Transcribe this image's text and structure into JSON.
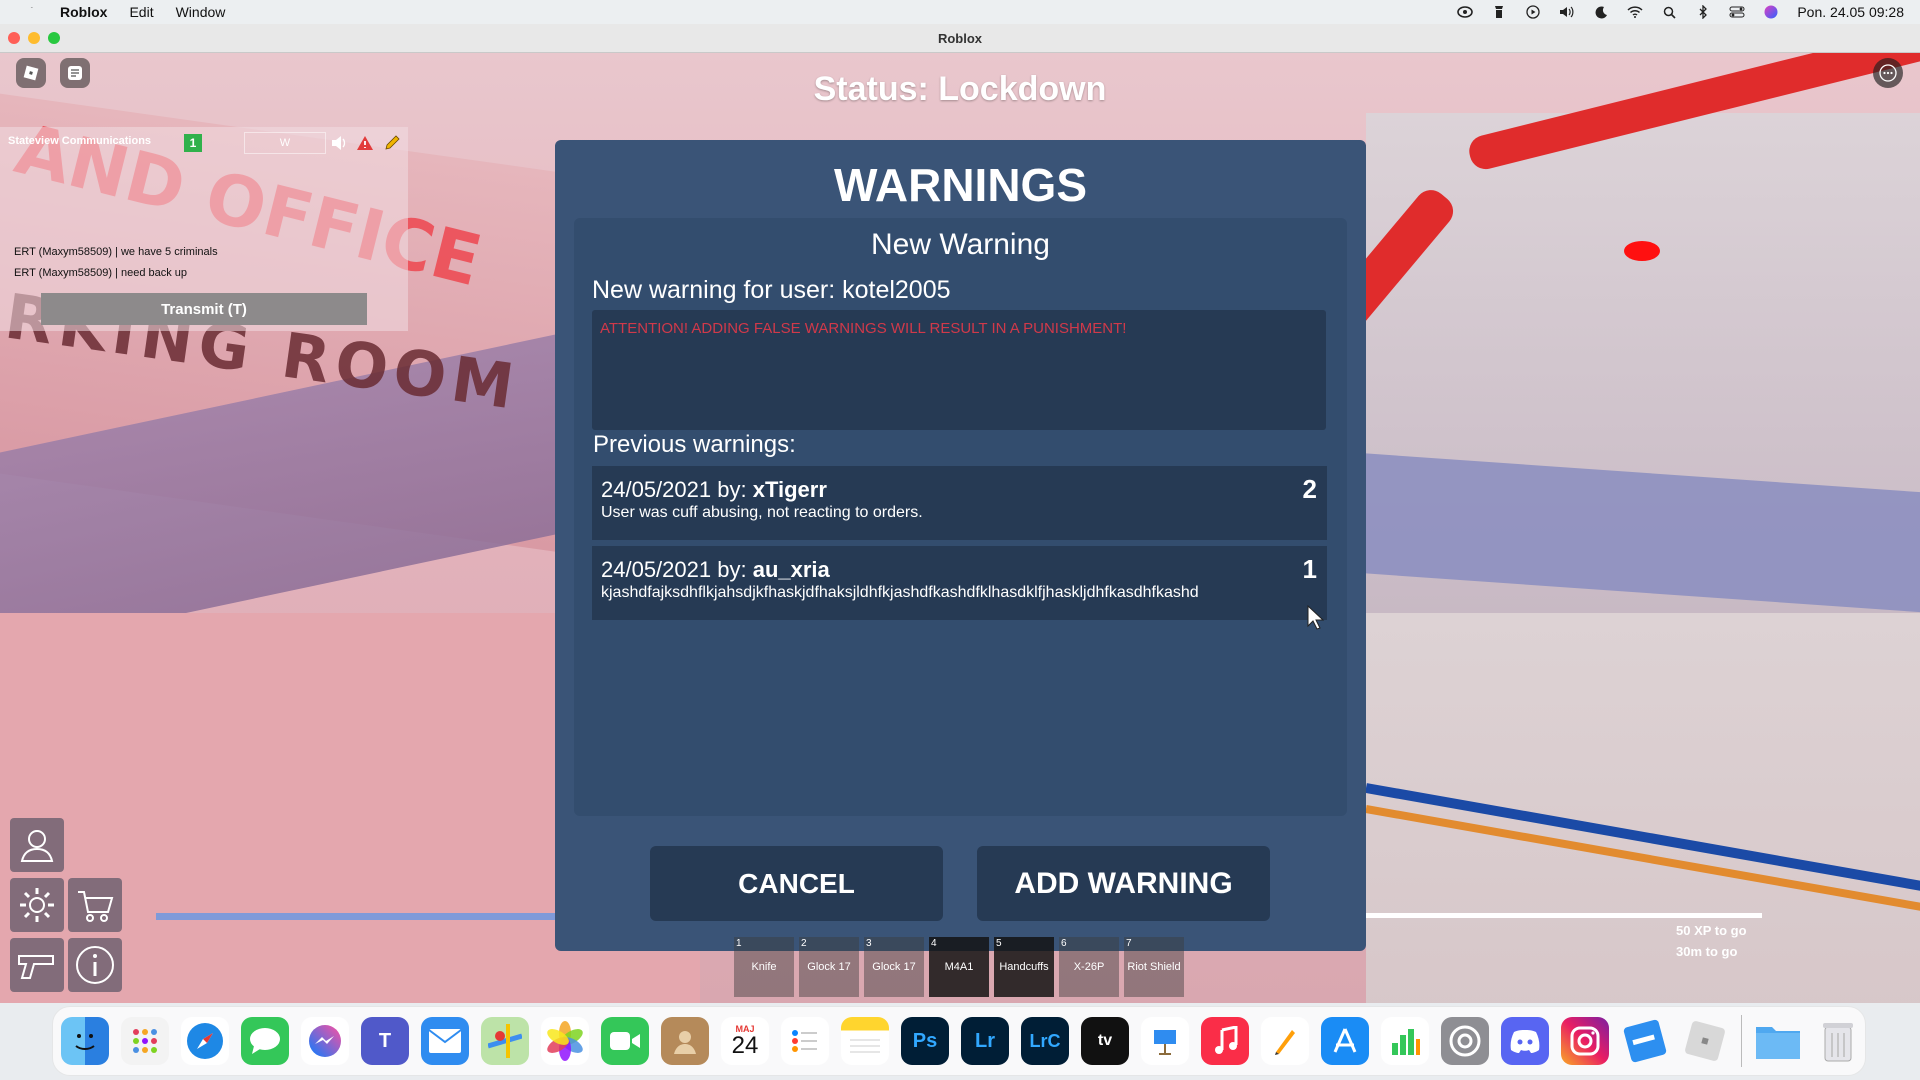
{
  "menubar": {
    "app_name": "Roblox",
    "menus": [
      "Edit",
      "Window"
    ],
    "clock": "Pon. 24.05  09:28"
  },
  "window": {
    "title": "Roblox"
  },
  "game": {
    "status": "Status: Lockdown",
    "radio": {
      "channel_name": "Stateview Communications",
      "count": "1",
      "channel_box": "W",
      "messages": [
        "ERT (Maxym58509) | we have 5 criminals",
        "ERT (Maxym58509) | need back up"
      ],
      "transmit_label": "Transmit (T)"
    },
    "xp": {
      "to_go": "50 XP to go",
      "time_to_go": "30m to go",
      "left_bar_fill": 0.0,
      "right_bar_fill": 1.0
    },
    "wall_text_dark": "RKING ROOM",
    "wall_text_red": "AND OFFICE"
  },
  "dialog": {
    "title": "WARNINGS",
    "section_title": "New Warning",
    "user_label": "New warning for user: kotel2005",
    "textarea_placeholder": "ATTENTION! ADDING FALSE WARNINGS WILL RESULT IN A PUNISHMENT!",
    "previous_label": "Previous warnings:",
    "warnings": [
      {
        "date": "24/05/2021 by:",
        "author": "xTigerr",
        "text": "User was cuff abusing, not reacting to orders.",
        "number": "2"
      },
      {
        "date": "24/05/2021 by:",
        "author": "au_xria",
        "text": "kjashdfajksdhflkjahsdjkfhaskjdfhaksjldhfkjashdfkashdfklhasdklfjhaskljdhfkasdhfkashd",
        "number": "1"
      }
    ],
    "cancel_label": "CANCEL",
    "add_label": "ADD WARNING"
  },
  "hotbar": [
    {
      "num": "1",
      "label": "Knife"
    },
    {
      "num": "2",
      "label": "Glock 17"
    },
    {
      "num": "3",
      "label": "Glock 17"
    },
    {
      "num": "4",
      "label": "M4A1"
    },
    {
      "num": "5",
      "label": "Handcuffs"
    },
    {
      "num": "6",
      "label": "X-26P"
    },
    {
      "num": "7",
      "label": "Riot Shield"
    }
  ],
  "dock": {
    "calendar_month": "MAJ",
    "calendar_day": "24",
    "apps": [
      "Finder",
      "Launchpad",
      "Safari",
      "Messages",
      "Messenger",
      "Teams",
      "Mail",
      "Maps",
      "Photos",
      "FaceTime",
      "Contacts",
      "Calendar",
      "Reminders",
      "Notes",
      "Photoshop",
      "Lightroom",
      "Lightroom Classic",
      "TV",
      "Keynote",
      "Music",
      "Pages",
      "App Store",
      "Numbers",
      "System Preferences",
      "Discord",
      "Instagram",
      "Roblox Studio",
      "Roblox",
      "Downloads",
      "Trash"
    ],
    "labels": {
      "ps": "Ps",
      "lr": "Lr",
      "lrc": "LrC",
      "tv": "tv",
      "teams": "T"
    }
  }
}
